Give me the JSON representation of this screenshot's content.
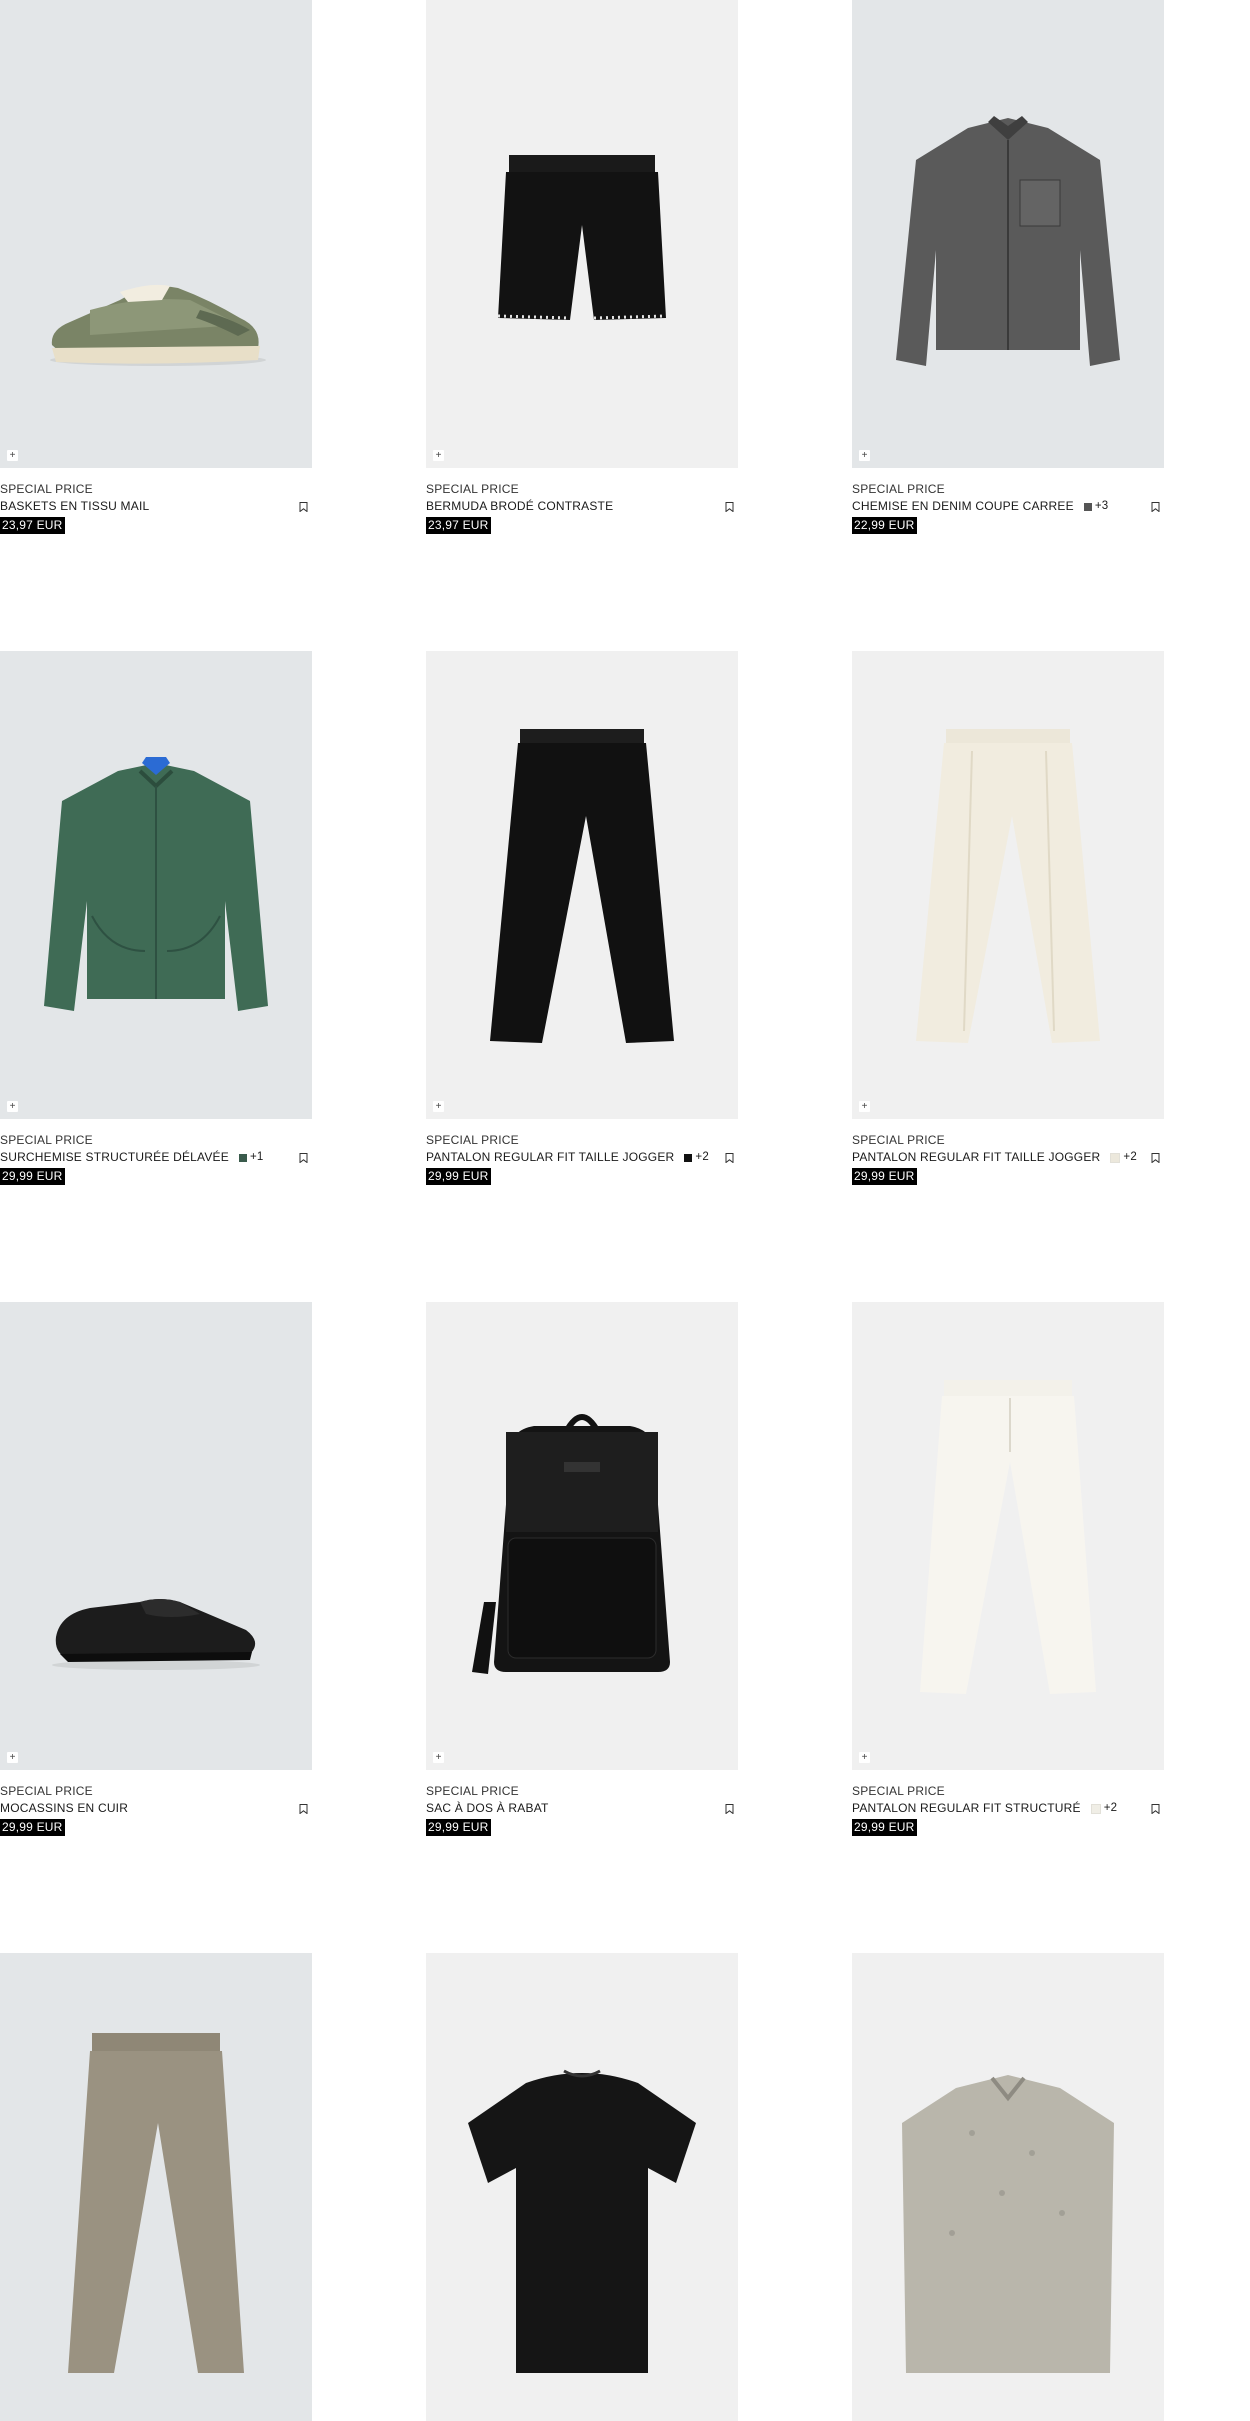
{
  "products": [
    {
      "tag": "SPECIAL PRICE",
      "name": "BASKETS EN TISSU MAIL",
      "price": "23,97 EUR",
      "colors_count": "",
      "swatch": "",
      "bg": "#e3e6e8",
      "icon": "sneaker"
    },
    {
      "tag": "SPECIAL PRICE",
      "name": "BERMUDA BRODÉ CONTRASTE",
      "price": "23,97 EUR",
      "colors_count": "",
      "swatch": "",
      "bg": "#f0f0f0",
      "icon": "shorts"
    },
    {
      "tag": "SPECIAL PRICE",
      "name": "CHEMISE EN DENIM COUPE CARREE",
      "price": "22,99 EUR",
      "colors_count": "+3",
      "swatch": "#555555",
      "bg": "#e3e6e8",
      "icon": "denim-shirt"
    },
    {
      "tag": "SPECIAL PRICE",
      "name": "SURCHEMISE STRUCTURÉE DÉLAVÉE",
      "price": "29,99 EUR",
      "colors_count": "+1",
      "swatch": "#3a5b4c",
      "bg": "#e3e6e8",
      "icon": "green-overshirt"
    },
    {
      "tag": "SPECIAL PRICE",
      "name": "PANTALON REGULAR FIT TAILLE JOGGER",
      "price": "29,99 EUR",
      "colors_count": "+2",
      "swatch": "#111111",
      "bg": "#f0f0f0",
      "icon": "black-trousers"
    },
    {
      "tag": "SPECIAL PRICE",
      "name": "PANTALON REGULAR FIT TAILLE JOGGER",
      "price": "29,99 EUR",
      "colors_count": "+2",
      "swatch": "#ece8dc",
      "bg": "#f0f0f0",
      "icon": "cream-trousers"
    },
    {
      "tag": "SPECIAL PRICE",
      "name": "MOCASSINS EN CUIR",
      "price": "29,99 EUR",
      "colors_count": "",
      "swatch": "",
      "bg": "#e3e6e8",
      "icon": "loafer"
    },
    {
      "tag": "SPECIAL PRICE",
      "name": "SAC À DOS À RABAT",
      "price": "29,99 EUR",
      "colors_count": "",
      "swatch": "",
      "bg": "#f0f0f0",
      "icon": "backpack"
    },
    {
      "tag": "SPECIAL PRICE",
      "name": "PANTALON REGULAR FIT STRUCTURÉ",
      "price": "29,99 EUR",
      "colors_count": "+2",
      "swatch": "#f0eee6",
      "bg": "#f0f0f0",
      "icon": "white-trousers"
    },
    {
      "tag": "",
      "name": "",
      "price": "",
      "colors_count": "",
      "swatch": "",
      "bg": "#e3e6e8",
      "icon": "khaki-trousers"
    },
    {
      "tag": "",
      "name": "",
      "price": "",
      "colors_count": "",
      "swatch": "",
      "bg": "#f0f0f0",
      "icon": "black-tee"
    },
    {
      "tag": "",
      "name": "",
      "price": "",
      "colors_count": "",
      "swatch": "",
      "bg": "#f0f0f0",
      "icon": "knit-shirt"
    }
  ],
  "quick_add_symbol": "+"
}
